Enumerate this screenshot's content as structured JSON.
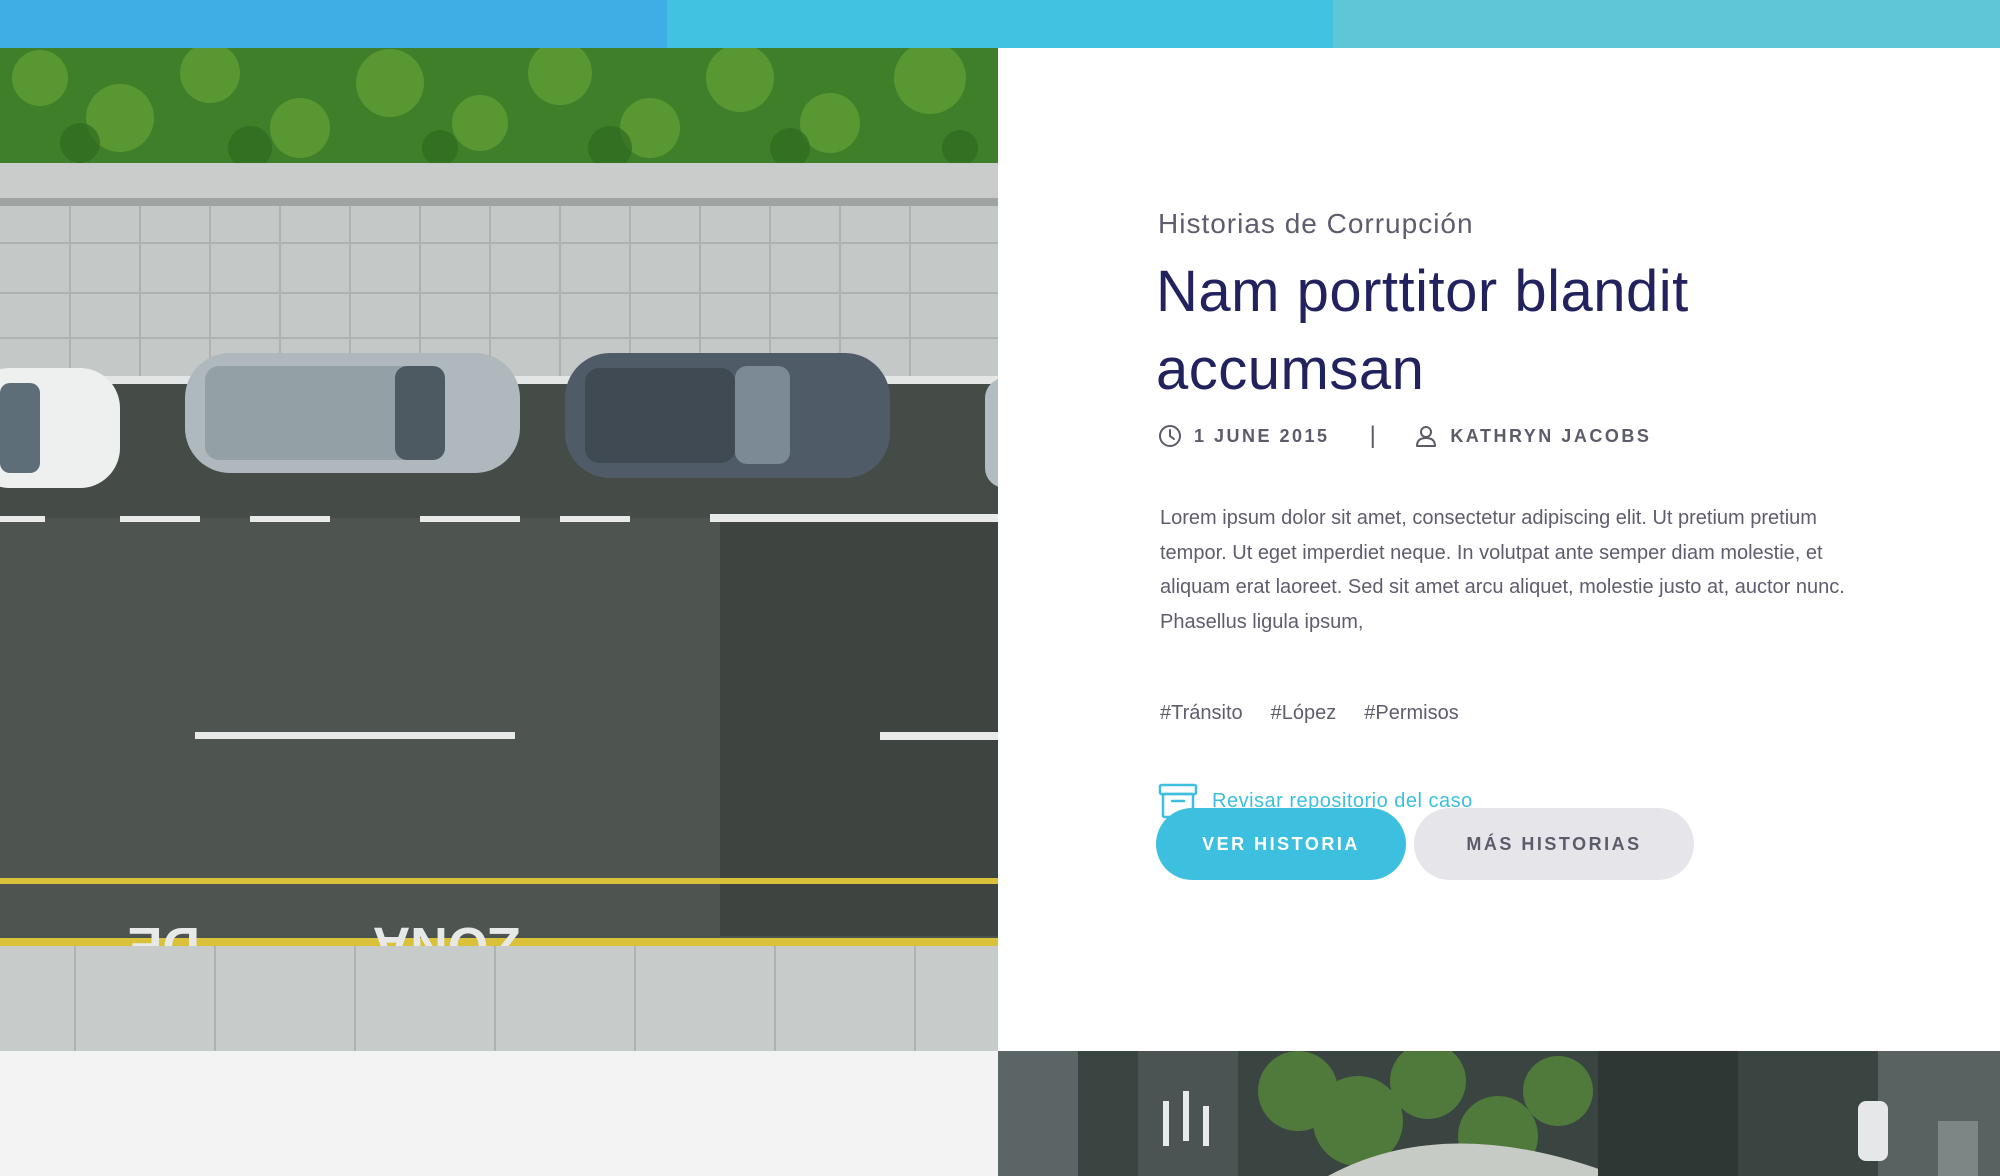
{
  "colors": {
    "strip": [
      "#3eaee4",
      "#41c2e0",
      "#5ec6d6"
    ],
    "accent": "#3dbfdf",
    "title": "#22225e",
    "text": "#5d5d6e"
  },
  "article": {
    "category": "Historias de Corrupción",
    "title": "Nam porttitor blandit accumsan",
    "date": "1 JUNE 2015",
    "separator": "|",
    "author": "KATHRYN JACOBS",
    "excerpt": "Lorem ipsum dolor sit amet, consectetur adipiscing elit. Ut pretium pretium tempor. Ut eget imperdiet neque. In volutpat ante semper diam molestie, et aliquam erat laoreet. Sed sit amet arcu aliquet, molestie justo at, auctor nunc. Phasellus ligula ipsum,",
    "tags": [
      "#Tránsito",
      "#López",
      "#Permisos"
    ],
    "repo_link": "Revisar repositorio del caso"
  },
  "buttons": {
    "primary": "VER HISTORIA",
    "secondary": "MÁS HISTORIAS"
  },
  "icons": {
    "date": "clock-icon",
    "author": "user-icon",
    "repo": "archive-box-icon"
  }
}
